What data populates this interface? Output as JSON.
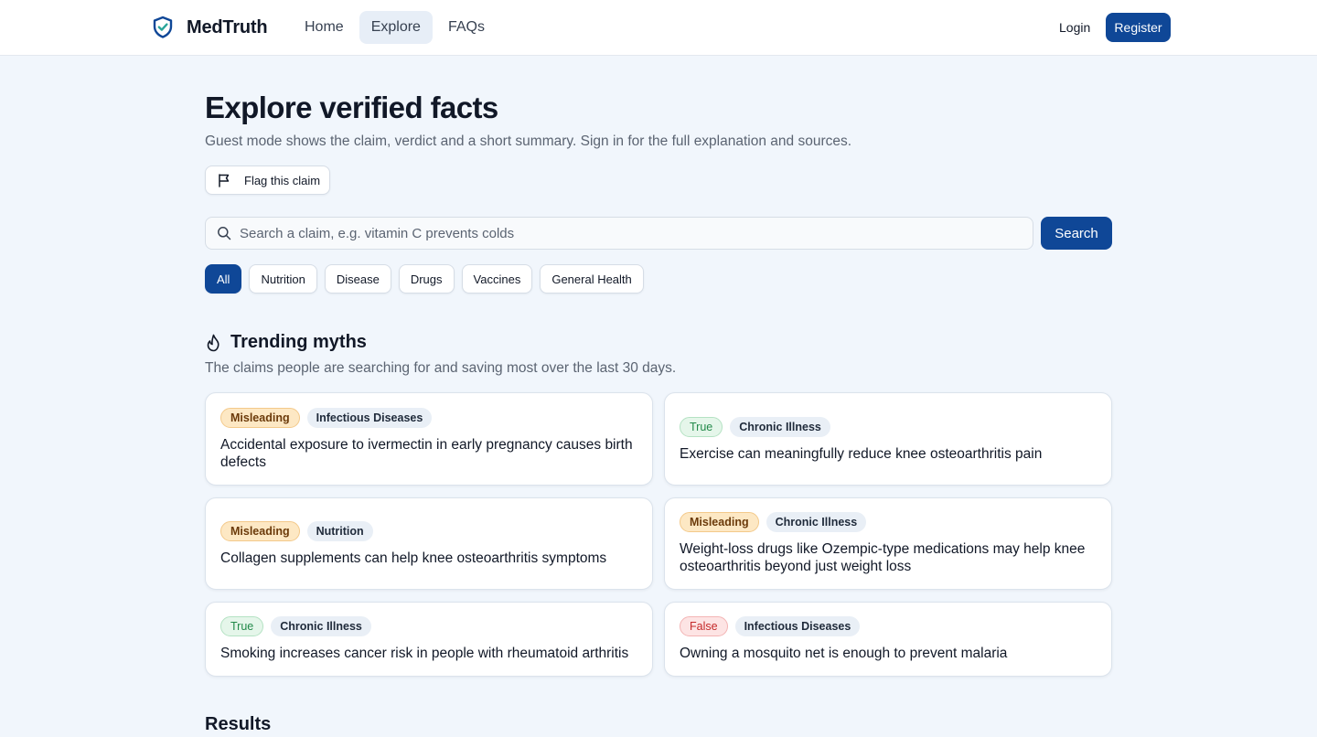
{
  "header": {
    "brand": "MedTruth",
    "nav": [
      "Home",
      "Explore",
      "FAQs"
    ],
    "login": "Login",
    "register": "Register"
  },
  "page": {
    "title": "Explore verified facts",
    "subtitle": "Guest mode shows the claim, verdict and a short summary. Sign in for the full explanation and sources.",
    "flag_label": "Flag this claim",
    "search_placeholder": "Search a claim, e.g. vitamin C prevents colds",
    "search_button": "Search",
    "filters": [
      "All",
      "Nutrition",
      "Disease",
      "Drugs",
      "Vaccines",
      "General Health"
    ],
    "active_filter": "All"
  },
  "trending": {
    "title": "Trending myths",
    "subtitle": "The claims people are searching for and saving most over the last 30 days.",
    "cards": [
      {
        "verdict": "Misleading",
        "category": "Infectious Diseases",
        "claim": "Accidental exposure to ivermectin in early pregnancy causes birth defects"
      },
      {
        "verdict": "True",
        "category": "Chronic Illness",
        "claim": "Exercise can meaningfully reduce knee osteoarthritis pain"
      },
      {
        "verdict": "Misleading",
        "category": "Nutrition",
        "claim": "Collagen supplements can help knee osteoarthritis symptoms"
      },
      {
        "verdict": "Misleading",
        "category": "Chronic Illness",
        "claim": "Weight-loss drugs like Ozempic-type medications may help knee osteoarthritis beyond just weight loss"
      },
      {
        "verdict": "True",
        "category": "Chronic Illness",
        "claim": "Smoking increases cancer risk in people with rheumatoid arthritis"
      },
      {
        "verdict": "False",
        "category": "Infectious Diseases",
        "claim": "Owning a mosquito net is enough to prevent malaria"
      }
    ]
  },
  "results": {
    "title": "Results"
  },
  "colors": {
    "primary": "#0f4797",
    "background": "#f1f6fc",
    "misleading": "#fde8c4",
    "true": "#e5f6ea",
    "false": "#fde4e4"
  },
  "icons": {
    "brand": "shield-check-icon",
    "flag": "flag-icon",
    "search": "search-icon",
    "trending": "flame-icon"
  }
}
